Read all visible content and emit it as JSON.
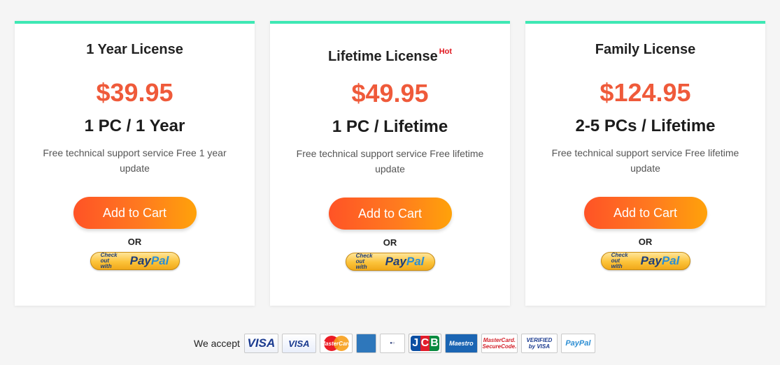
{
  "plans": [
    {
      "title": "1 Year License",
      "badge": "",
      "price": "$39.95",
      "subtitle": "1 PC / 1 Year",
      "description": "Free technical support service Free 1 year update",
      "cart_label": "Add to Cart",
      "or_label": "OR"
    },
    {
      "title": "Lifetime License",
      "badge": "Hot",
      "price": "$49.95",
      "subtitle": "1 PC / Lifetime",
      "description": "Free technical support service Free lifetime update",
      "cart_label": "Add to Cart",
      "or_label": "OR"
    },
    {
      "title": "Family License",
      "badge": "",
      "price": "$124.95",
      "subtitle": "2-5 PCs / Lifetime",
      "description": "Free technical support service Free lifetime update",
      "cart_label": "Add to Cart",
      "or_label": "OR"
    }
  ],
  "paypal_button": {
    "small_text_1": "Check out",
    "small_text_2": "with",
    "logo_pay": "Pay",
    "logo_pal": "Pal"
  },
  "accept": {
    "label": "We accept",
    "logos": [
      {
        "icon": "visa-logo",
        "text": "VISA"
      },
      {
        "icon": "visa-electron-logo",
        "text": "VISA"
      },
      {
        "icon": "mastercard-logo",
        "text": "MasterCard"
      },
      {
        "icon": "american-express-logo",
        "text": "AMERICAN EXPRESS"
      },
      {
        "icon": "diners-club-logo",
        "text": "Diners Club International"
      },
      {
        "icon": "jcb-logo",
        "text": "JCB"
      },
      {
        "icon": "maestro-logo",
        "text": "Maestro"
      },
      {
        "icon": "mastercard-securecode-logo",
        "text": "MasterCard SecureCode"
      },
      {
        "icon": "verified-by-visa-logo",
        "text": "VERIFIED by VISA"
      },
      {
        "icon": "paypal-logo",
        "text": "PayPal"
      }
    ]
  },
  "colors": {
    "accent_top_border": "#3ee8b4",
    "price": "#ef5a3a",
    "hot_badge": "#e0161e",
    "cart_gradient_start": "#ff5326",
    "cart_gradient_end": "#ffa20a"
  }
}
